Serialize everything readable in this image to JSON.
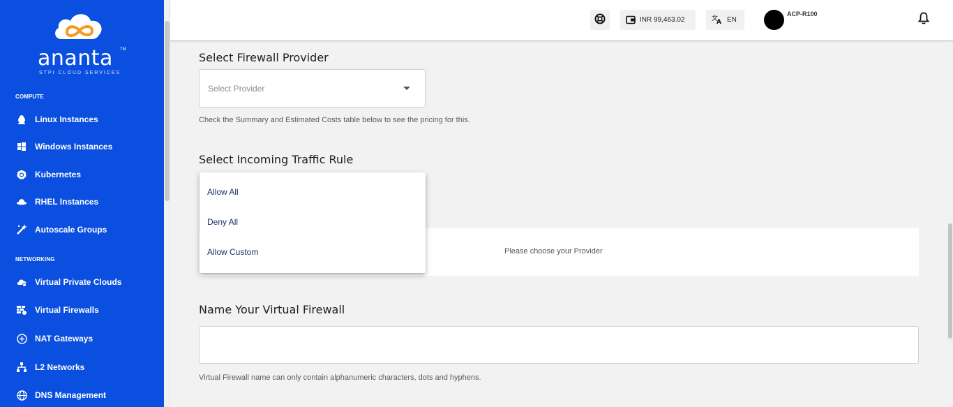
{
  "brand": {
    "name": "ananta",
    "tagline": "STPI CLOUD SERVICES",
    "tm": "TM"
  },
  "sidebar": {
    "sections": [
      {
        "label": "COMPUTE",
        "items": [
          {
            "label": "Linux Instances",
            "icon": "linux-icon"
          },
          {
            "label": "Windows Instances",
            "icon": "windows-icon"
          },
          {
            "label": "Kubernetes",
            "icon": "kubernetes-icon"
          },
          {
            "label": "RHEL Instances",
            "icon": "redhat-icon"
          },
          {
            "label": "Autoscale Groups",
            "icon": "magic-wand-icon"
          }
        ]
      },
      {
        "label": "NETWORKING",
        "items": [
          {
            "label": "Virtual Private Clouds",
            "icon": "cloud-network-icon"
          },
          {
            "label": "Virtual Firewalls",
            "icon": "firewall-icon"
          },
          {
            "label": "NAT Gateways",
            "icon": "gateway-icon"
          },
          {
            "label": "L2 Networks",
            "icon": "network-tree-icon"
          },
          {
            "label": "DNS Management",
            "icon": "globe-icon"
          }
        ]
      }
    ]
  },
  "header": {
    "wallet": "INR 99,463.02",
    "language": "EN",
    "account": "ACP-R100"
  },
  "form": {
    "provider_title": "Select Firewall Provider",
    "provider_placeholder": "Select Provider",
    "provider_hint": "Check the Summary and Estimated Costs table below to see the pricing for this.",
    "traffic_title": "Select Incoming Traffic Rule",
    "traffic_options": [
      "Allow All",
      "Deny All",
      "Allow Custom"
    ],
    "summary_message": "Please choose your Provider",
    "name_title": "Name Your Virtual Firewall",
    "name_value": "",
    "name_hint": "Virtual Firewall name can only contain alphanumeric characters, dots and hyphens."
  },
  "colors": {
    "sidebar": "#0a4fe0",
    "logo_orange": "#f39a1e",
    "dropdown_text": "#1b2f6b"
  }
}
